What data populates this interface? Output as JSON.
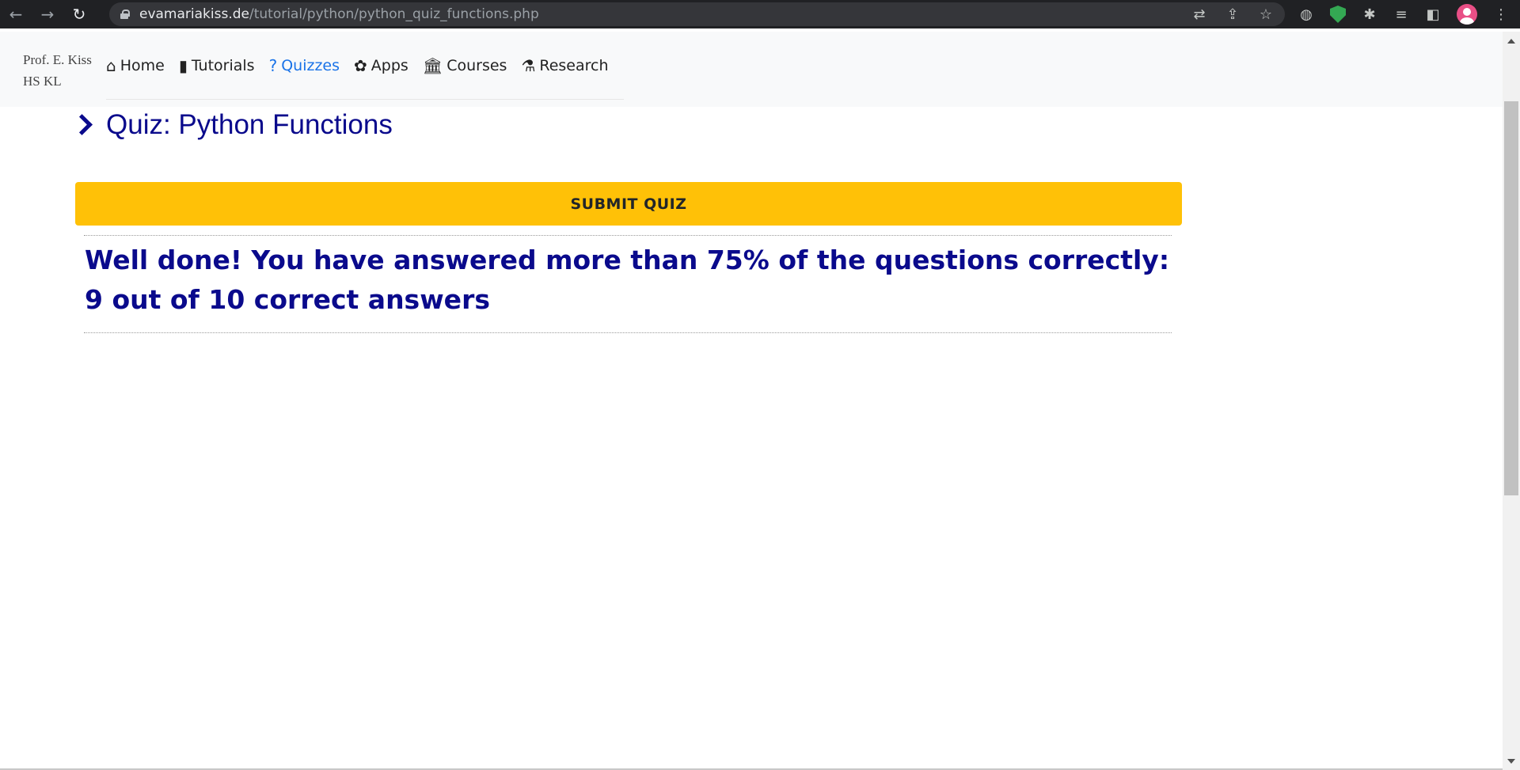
{
  "browser": {
    "url_host": "evamariakiss.de",
    "url_path": "/tutorial/python/python_quiz_functions.php",
    "back_icon": "arrow-left-icon",
    "forward_icon": "arrow-right-icon",
    "reload_icon": "reload-icon"
  },
  "site": {
    "brand_line1": "Prof. E. Kiss",
    "brand_line2": "HS KL",
    "nav": [
      {
        "label": "Home",
        "icon": "home-icon",
        "glyph": "⌂"
      },
      {
        "label": "Tutorials",
        "icon": "book-icon",
        "glyph": "▮"
      },
      {
        "label": "Quizzes",
        "icon": "question-icon",
        "glyph": "?"
      },
      {
        "label": "Apps",
        "icon": "python-icon",
        "glyph": "✿"
      },
      {
        "label": "Courses",
        "icon": "university-icon",
        "glyph": "🏛"
      },
      {
        "label": "Research",
        "icon": "research-icon",
        "glyph": "⚗"
      }
    ],
    "active_nav": "Quizzes"
  },
  "main": {
    "title": "Quiz: Python Functions",
    "submit_label": "SUBMIT QUIZ",
    "result_line1": "Well done! You have answered more than 75% of the questions correctly:",
    "result_line2": "9 out of 10 correct answers"
  },
  "colors": {
    "accent": "#0a0a8c",
    "button": "#ffc107",
    "active_link": "#1a73e8"
  }
}
